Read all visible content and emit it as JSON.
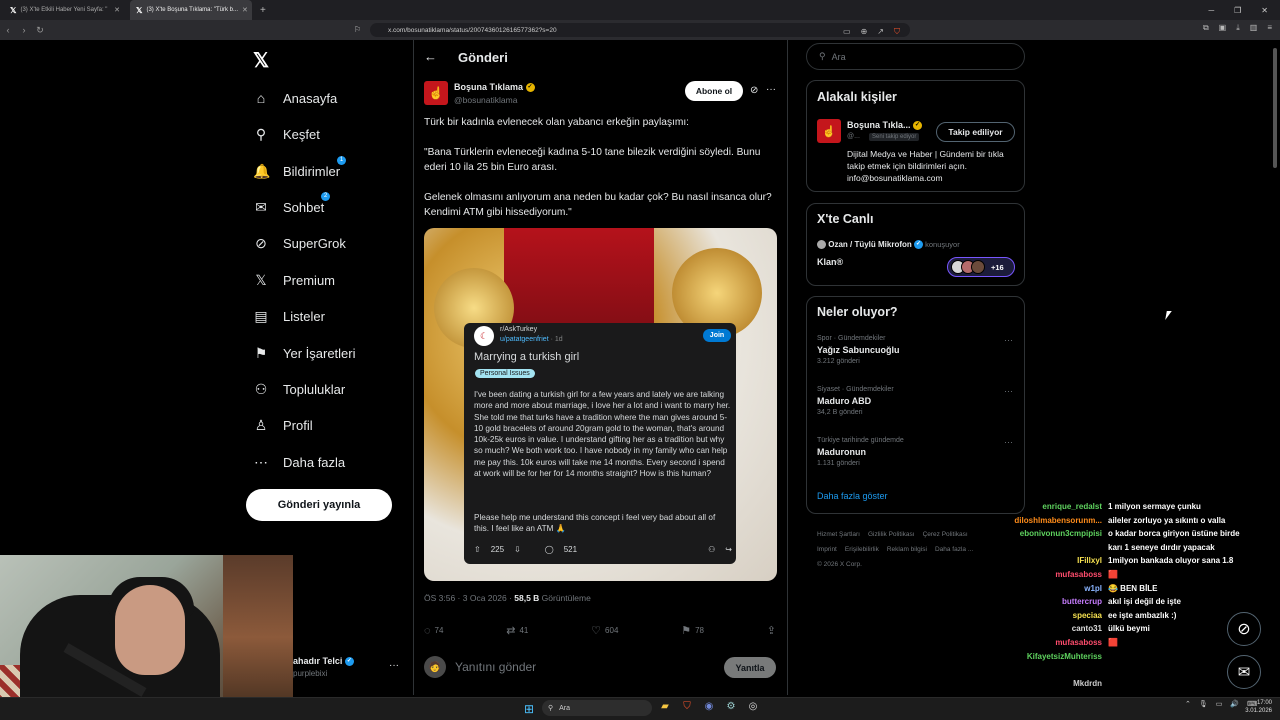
{
  "browser": {
    "tabs": [
      {
        "label": "(3) X'te Etkili Haber Yeni Sayfa: \"",
        "active": false
      },
      {
        "label": "(3) X'te Boşuna Tıklama: \"Türk b...",
        "active": true
      }
    ],
    "new_tab": "+",
    "url": "x.com/bosunatiklama/status/2007436012616577362?s=20"
  },
  "nav": {
    "items": [
      {
        "label": "Anasayfa",
        "icon": "home-icon",
        "glyph": "⌂"
      },
      {
        "label": "Keşfet",
        "icon": "search-icon",
        "glyph": "⚲"
      },
      {
        "label": "Bildirimler",
        "icon": "bell-icon",
        "glyph": "🔔",
        "badge": "1"
      },
      {
        "label": "Sohbet",
        "icon": "mail-icon",
        "glyph": "✉",
        "badge": "2"
      },
      {
        "label": "SuperGrok",
        "icon": "grok-icon",
        "glyph": "⊘"
      },
      {
        "label": "Premium",
        "icon": "x-icon",
        "glyph": "𝕏"
      },
      {
        "label": "Listeler",
        "icon": "list-icon",
        "glyph": "▤"
      },
      {
        "label": "Yer İşaretleri",
        "icon": "bookmark-icon",
        "glyph": "⚑"
      },
      {
        "label": "Topluluklar",
        "icon": "communities-icon",
        "glyph": "⚇"
      },
      {
        "label": "Profil",
        "icon": "profile-icon",
        "glyph": "♙"
      },
      {
        "label": "Daha fazla",
        "icon": "more-circle-icon",
        "glyph": "⋯"
      }
    ],
    "post_button": "Gönderi yayınla",
    "account": {
      "name": "ahadır Telci",
      "handle": "purplebixi"
    }
  },
  "post": {
    "page_title": "Gönderi",
    "author_name": "Boşuna Tıklama",
    "author_handle": "@bosunatiklama",
    "subscribe": "Abone ol",
    "text1": "Türk bir kadınla evlenecek olan yabancı erkeğin paylaşımı:",
    "text2": "\"Bana Türklerin evleneceği kadına 5-10 tane bilezik verdiğini söyledi. Bunu ederi 10 ila 25 bin Euro arası.",
    "text3": "Gelenek olmasını anlıyorum ana neden bu kadar çok? Bu nasıl insanca olur? Kendimi ATM gibi hissediyorum.\"",
    "timestamp": "ÖS 3:56 · 3 Oca 2026 · ",
    "views": "58,5 B",
    "views_label": " Görüntüleme",
    "stats": {
      "replies": "74",
      "reposts": "41",
      "likes": "604",
      "bookmarks": "78"
    },
    "reply_placeholder": "Yanıtını gönder",
    "reply_button": "Yanıtla"
  },
  "reddit": {
    "subreddit": "r/AskTurkey",
    "user": "u/patatgeenfriet",
    "age": " · 1d",
    "join": "Join",
    "title": "Marrying a turkish girl",
    "flair": "Personal Issues",
    "body": "I've been dating a turkish girl for a few years and lately we are talking more and more about marriage, i love her a lot and i want to marry her. She told me that turks have a tradition where the man gives around 5-10 gold bracelets of around 20gram gold to the woman, that's around 10k-25k euros in value. I understand gifting her as a tradition but why so much? We both work too. I have nobody in my family who can help me pay this. 10k euros will take me 14 months. Every second i spend at work will be for her for 14 months straight? How is this human?",
    "body2": "Please help me understand this concept i feel very bad about all of this. I feel like an ATM 🙏",
    "upvotes": "225",
    "comments": "521"
  },
  "right": {
    "search_placeholder": "Ara",
    "related_title": "Alakalı kişiler",
    "related": {
      "name": "Boşuna Tıkla...",
      "handle": "@...",
      "follows_you": "Seni takip ediyor",
      "button": "Takip ediliyor",
      "bio": "Dijital Medya ve Haber | Gündemi bir tıkla takip etmek için bildirimleri açın. info@bosunatiklama.com"
    },
    "live_title": "X'te Canlı",
    "live": {
      "host": "Ozan / Tüylü Mikrofon",
      "status": " konuşuyor",
      "title": "Klan®",
      "count": "+16"
    },
    "trends_title": "Neler oluyor?",
    "trends": [
      {
        "category": "Spor · Gündemdekiler",
        "name": "Yağız Sabuncuoğlu",
        "count": "3.212 gönderi"
      },
      {
        "category": "Siyaset · Gündemdekiler",
        "name": "Maduro ABD",
        "count": "34,2 B gönderi"
      },
      {
        "category": "Türkiye tarihinde gündemde",
        "name": "Maduronun",
        "count": "1.131 gönderi"
      }
    ],
    "show_more": "Daha fazla göster",
    "footer": [
      "Hizmet Şartları",
      "Gizlilik Politikası",
      "Çerez Politikası",
      "Imprint",
      "Erişilebilirlik",
      "Reklam bilgisi",
      "Daha fazla ...",
      "© 2026 X Corp."
    ]
  },
  "chat": [
    {
      "user": "enrique_redalst",
      "color": "#5fd35f",
      "msg": "1 milyon sermaye çunku"
    },
    {
      "user": "diloshlmabensorunm...",
      "color": "#ff8c1a",
      "msg": "aileler zorluyo ya sıkıntı o valla"
    },
    {
      "user": "ebonivonun3cmpipisi",
      "color": "#5fd35f",
      "msg": "o kadar borca giriyon üstüne birde"
    },
    {
      "user": "",
      "color": "#fff",
      "msg": "karı 1 seneye dırdır yapacak"
    },
    {
      "user": "IFillxyl",
      "color": "#f5e050",
      "msg": "1milyon bankada oluyor sana 1.8"
    },
    {
      "user": "mufasaboss",
      "color": "#ff4d6d",
      "msg": "🟥"
    },
    {
      "user": "w1pl",
      "color": "#8ab4ff",
      "msg": "😂 BEN BİLE"
    },
    {
      "user": "buttercrup",
      "color": "#c77dff",
      "msg": "akıl işi değil de işte"
    },
    {
      "user": "speciaa",
      "color": "#f5e050",
      "msg": "ee işte ambazlık :)"
    },
    {
      "user": "canto31",
      "color": "#dddddd",
      "msg": "ülkü beymi"
    },
    {
      "user": "mufasaboss",
      "color": "#ff4d6d",
      "msg": "🟥"
    },
    {
      "user": "KifayetsizMuhteriss",
      "color": "#5fd35f",
      "msg": ""
    },
    {
      "user": "",
      "color": "#fff",
      "msg": ""
    },
    {
      "user": "Mkdrdn",
      "color": "#cccccc",
      "msg": ""
    }
  ],
  "taskbar": {
    "search": "Ara",
    "time": "17:00",
    "date": "3.01.2026"
  }
}
